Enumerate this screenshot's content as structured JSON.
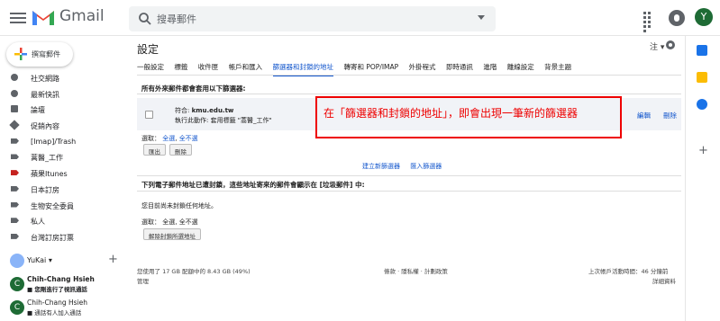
{
  "header": {
    "logo_text": "Gmail",
    "search_placeholder": "搜尋郵件",
    "avatar_letter": "Y"
  },
  "compose": {
    "label": "撰寫郵件"
  },
  "sidebar": {
    "items": [
      {
        "label": "社交網路",
        "icon": "people-icon"
      },
      {
        "label": "最新快訊",
        "icon": "info-icon"
      },
      {
        "label": "論壇",
        "icon": "forum-icon"
      },
      {
        "label": "促銷內容",
        "icon": "tag-icon"
      },
      {
        "label": "[Imap]/Trash",
        "icon": "label-icon"
      },
      {
        "label": "蒿醫_工作",
        "icon": "label-icon"
      },
      {
        "label": "蘋果Itunes",
        "icon": "label-icon-red"
      },
      {
        "label": "日本訂房",
        "icon": "label-icon"
      },
      {
        "label": "生物安全委員",
        "icon": "label-icon"
      },
      {
        "label": "私人",
        "icon": "label-icon"
      },
      {
        "label": "台灣訂房訂票",
        "icon": "label-icon"
      }
    ],
    "user": {
      "name": "YuKai ▾",
      "add": "+"
    },
    "hangouts": [
      {
        "avatar": "C",
        "name": "Chih-Chang Hsieh",
        "sub": "■ 您剛進行了視訊通話"
      },
      {
        "avatar": "C",
        "name": "Chih-Chang Hsieh",
        "sub": "■ 通話有人加入通話"
      }
    ]
  },
  "main": {
    "title": "設定",
    "lang_label": "注 ▾",
    "tabs": [
      "一般設定",
      "標籤",
      "收件匣",
      "帳戶和匯入",
      "篩選器和封鎖的地址",
      "轉寄和 POP/IMAP",
      "外掛程式",
      "即時通訊",
      "進階",
      "離線設定",
      "背景主題"
    ],
    "active_tab": "篩選器和封鎖的地址",
    "filters_heading": "所有外來郵件都會套用以下篩選器:",
    "filter": {
      "match_prefix": "符合:",
      "match_value": "kmu.edu.tw",
      "action": "執行此動作: 套用標籤 \"蒿醫_工作\"",
      "edit": "編輯",
      "delete": "刪除"
    },
    "annotation": "在「篩選器和封鎖的地址」，即會出現一筆新的篩選器",
    "select_prefix": "選取：",
    "select_all": "全選",
    "select_none": "全不選",
    "export_btn": "匯出",
    "delete_btn": "刪除",
    "create_filter": "建立新篩選器",
    "import_filter": "匯入篩選器",
    "blocked_heading": "下列電子郵件地址已遭封鎖，這些地址寄來的郵件會顯示在 [垃圾郵件] 中:",
    "blocked_none": "您目前尚未封鎖任何地址。",
    "unblock_btn": "解除封鎖所選地址",
    "footer": {
      "usage": "您使用了 17 GB 配額中的 8.43 GB (49%)",
      "manage": "管理",
      "terms": "條款 · 隱私權 · 計劃政策",
      "last_activity": "上次帳戶活動時間：46 分鐘前",
      "details": "詳細資料"
    }
  },
  "colors": {
    "link": "#1155cc",
    "annotation": "#e00000",
    "accent_red": "#c5221f"
  }
}
